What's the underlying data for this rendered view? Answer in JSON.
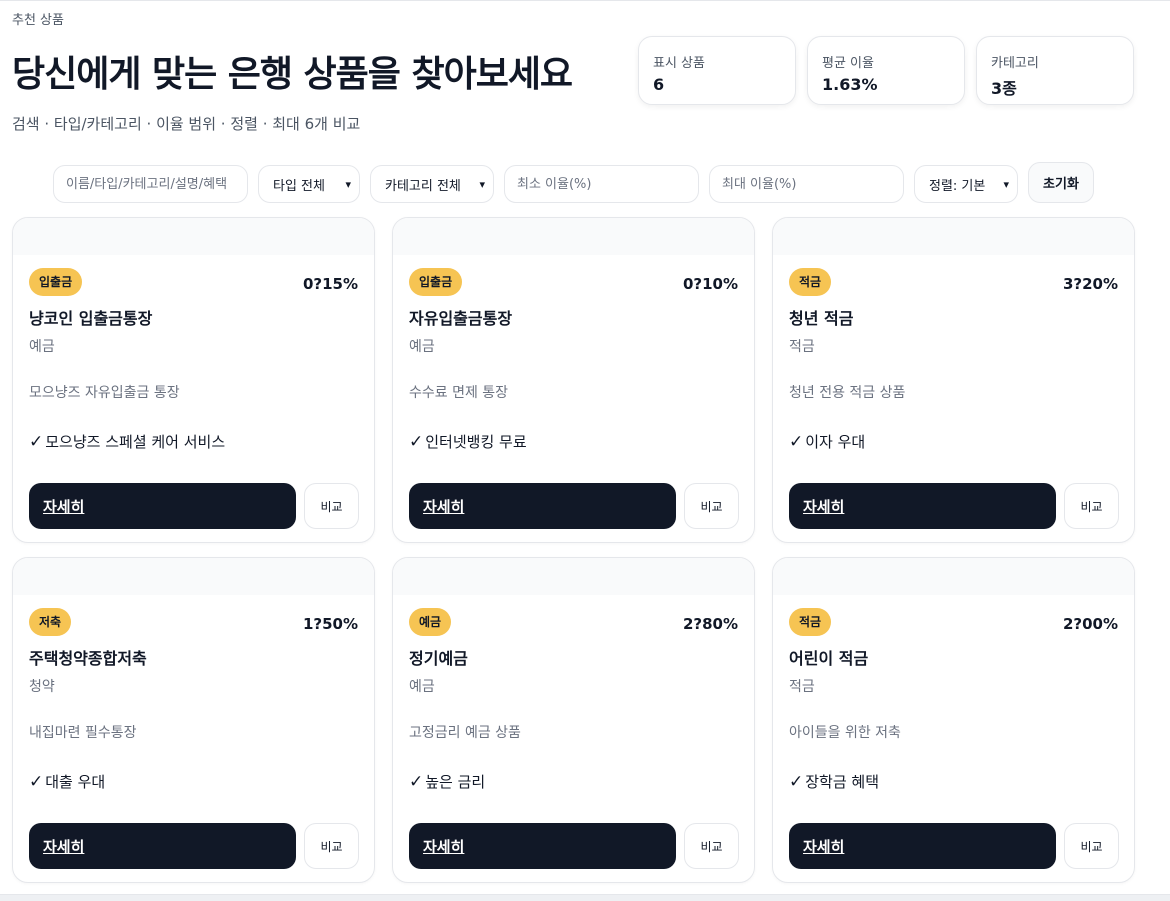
{
  "header": {
    "eyebrow": "추천 상품",
    "title": "당신에게 맞는 은행 상품을 찾아보세요",
    "subtitle": "검색 · 타입/카테고리 · 이율 범위 · 정렬 · 최대 6개 비교"
  },
  "stats": [
    {
      "label": "표시 상품",
      "value": "6"
    },
    {
      "label": "평균 이율",
      "value": "1.63%"
    },
    {
      "label": "카테고리",
      "value": "3종"
    }
  ],
  "filters": {
    "search_placeholder": "이름/타입/카테고리/설명/혜택",
    "type_select": "타입 전체",
    "category_select": "카테고리 전체",
    "min_rate_placeholder": "최소 이율(%)",
    "max_rate_placeholder": "최대 이율(%)",
    "sort_select": "정렬: 기본",
    "reset_label": "초기화"
  },
  "icons": {
    "select": "chevron-down-icon",
    "feature": "check-icon"
  },
  "colors": {
    "badge": "#f6c453",
    "primary_button": "#111827",
    "card_band": "#f9fafb"
  },
  "card_labels": {
    "detail": "자세히",
    "compare": "비교",
    "check": "✓"
  },
  "products": [
    {
      "badge": "입출금",
      "rate": "0?15%",
      "name": "냥코인 입출금통장",
      "category": "예금",
      "description": "모으냥즈 자유입출금 통장",
      "feature": "모으냥즈 스페셜 케어 서비스"
    },
    {
      "badge": "입출금",
      "rate": "0?10%",
      "name": "자유입출금통장",
      "category": "예금",
      "description": "수수료 면제 통장",
      "feature": "인터넷뱅킹 무료"
    },
    {
      "badge": "적금",
      "rate": "3?20%",
      "name": "청년 적금",
      "category": "적금",
      "description": "청년 전용 적금 상품",
      "feature": "이자 우대"
    },
    {
      "badge": "저축",
      "rate": "1?50%",
      "name": "주택청약종합저축",
      "category": "청약",
      "description": "내집마련 필수통장",
      "feature": "대출 우대"
    },
    {
      "badge": "예금",
      "rate": "2?80%",
      "name": "정기예금",
      "category": "예금",
      "description": "고정금리 예금 상품",
      "feature": "높은 금리"
    },
    {
      "badge": "적금",
      "rate": "2?00%",
      "name": "어린이 적금",
      "category": "적금",
      "description": "아이들을 위한 저축",
      "feature": "장학금 혜택"
    }
  ]
}
